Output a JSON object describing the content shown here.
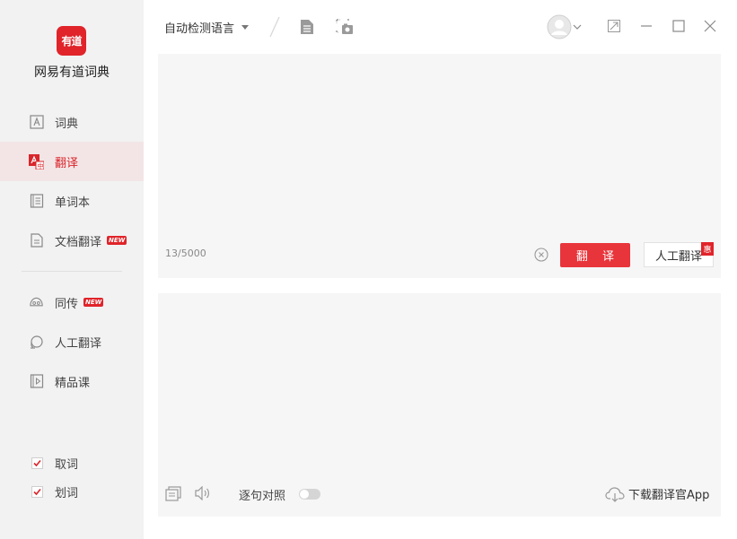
{
  "sidebar": {
    "logo_text": "有道",
    "app_name": "网易有道词典",
    "nav": [
      {
        "label": "词典",
        "icon": "dictionary-icon"
      },
      {
        "label": "翻译",
        "icon": "translate-icon",
        "active": true
      },
      {
        "label": "单词本",
        "icon": "wordbook-icon"
      },
      {
        "label": "文档翻译",
        "icon": "document-icon",
        "badge": "NEW"
      },
      {
        "label": "同传",
        "icon": "simultaneous-icon",
        "badge": "NEW"
      },
      {
        "label": "人工翻译",
        "icon": "human-translate-icon"
      },
      {
        "label": "精品课",
        "icon": "course-icon"
      }
    ],
    "checks": [
      {
        "label": "取词",
        "checked": true
      },
      {
        "label": "划词",
        "checked": true
      }
    ]
  },
  "topbar": {
    "language": "自动检测语言"
  },
  "input": {
    "counter": "13/5000",
    "translate_label": "翻 译",
    "human_label": "人工翻译",
    "human_badge": "惠"
  },
  "output": {
    "sentence_label": "逐句对照",
    "download_label": "下载翻译官App"
  },
  "colors": {
    "accent": "#e8353b",
    "sidebar_bg": "#f2f2f3",
    "panel_bg": "#f6f6f7"
  }
}
